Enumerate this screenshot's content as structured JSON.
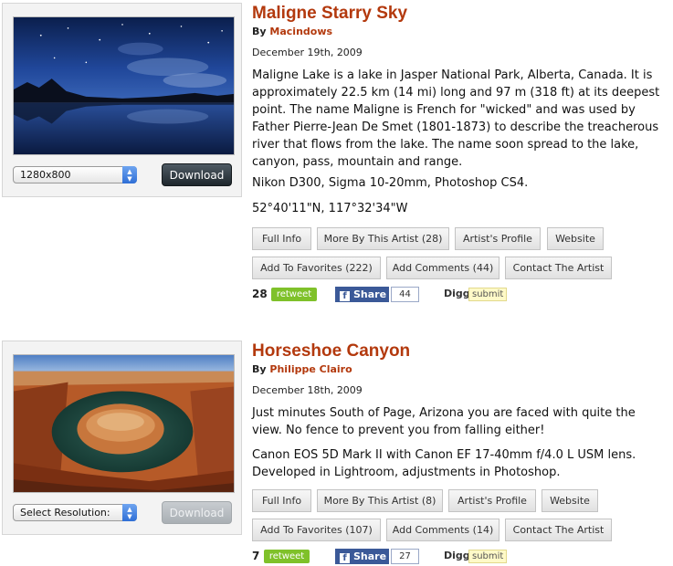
{
  "entries": [
    {
      "title": "Maligne Starry Sky",
      "by_prefix": "By",
      "artist": "Macindows",
      "date": "December 19th, 2009",
      "description": "Maligne Lake is a lake in Jasper National Park, Alberta, Canada. It is approximately 22.5 km (14 mi) long and 97 m (318 ft) at its deepest point. The name Maligne is French for \"wicked\" and was used by Father Pierre-Jean De Smet (1801-1873) to describe the treacherous river that flows from the lake. The name soon spread to the lake, canyon, pass, mountain and range.",
      "gear": "Nikon D300, Sigma 10-20mm, Photoshop CS4.",
      "coords": "52°40'11\"N, 117°32'34\"W",
      "resolution": "1280x800",
      "download_label": "Download",
      "buttons": {
        "full_info": "Full Info",
        "more_by_artist": "More By This Artist (28)",
        "artist_profile": "Artist's Profile",
        "website": "Website",
        "add_favorites": "Add To Favorites (222)",
        "add_comments": "Add Comments (44)",
        "contact_artist": "Contact The Artist"
      },
      "social": {
        "tweet_count": "28",
        "retweet": "retweet",
        "fb_share": "Share",
        "fb_count": "44",
        "digg": "Digg",
        "submit": "submit"
      }
    },
    {
      "title": "Horseshoe Canyon",
      "by_prefix": "By",
      "artist": "Philippe Clairo",
      "date": "December 18th, 2009",
      "description": "Just minutes South of Page, Arizona you are faced with quite the view. No fence to prevent you from falling either!",
      "gear": "Canon EOS 5D Mark II with Canon EF 17-40mm f/4.0 L USM lens. Developed in Lightroom, adjustments in Photoshop.",
      "resolution": "Select Resolution:",
      "download_label": "Download",
      "buttons": {
        "full_info": "Full Info",
        "more_by_artist": "More By This Artist (8)",
        "artist_profile": "Artist's Profile",
        "website": "Website",
        "add_favorites": "Add To Favorites (107)",
        "add_comments": "Add Comments (14)",
        "contact_artist": "Contact The Artist"
      },
      "social": {
        "tweet_count": "7",
        "retweet": "retweet",
        "fb_share": "Share",
        "fb_count": "27",
        "digg": "Digg",
        "submit": "submit"
      }
    }
  ],
  "colors": {
    "title": "#b3390d",
    "retweet": "#7fc12a",
    "facebook": "#3b5998",
    "download_active": "#2a3339",
    "download_disabled": "#b5babe"
  },
  "icons": {
    "select_arrow": "up-down-arrows-icon",
    "facebook": "facebook-f-icon"
  }
}
